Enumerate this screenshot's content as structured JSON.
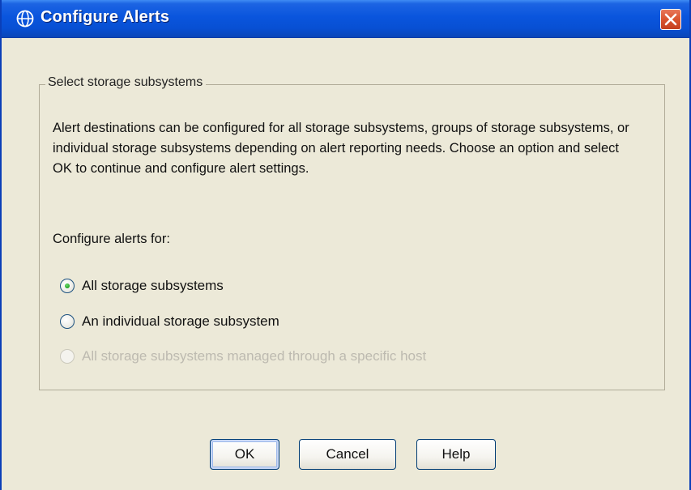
{
  "window": {
    "title": "Configure Alerts",
    "title_icon": "globe-icon",
    "close_icon": "close-icon"
  },
  "group": {
    "legend": "Select storage subsystems",
    "description": "Alert destinations can be configured for all storage subsystems, groups of storage subsystems, or individual storage subsystems depending on alert reporting needs.  Choose an option and select OK to continue and configure alert settings.",
    "configure_label": "Configure alerts for:",
    "options": [
      {
        "label": "All storage subsystems",
        "selected": true,
        "enabled": true
      },
      {
        "label": "An individual storage subsystem",
        "selected": false,
        "enabled": true
      },
      {
        "label": "All storage subsystems managed through a specific host",
        "selected": false,
        "enabled": false
      }
    ]
  },
  "buttons": {
    "ok": "OK",
    "cancel": "Cancel",
    "help": "Help"
  },
  "colors": {
    "titlebar": "#0a55dd",
    "window_bg": "#ECE9D8",
    "close_button": "#d9542e",
    "radio_selected": "#21a121"
  }
}
